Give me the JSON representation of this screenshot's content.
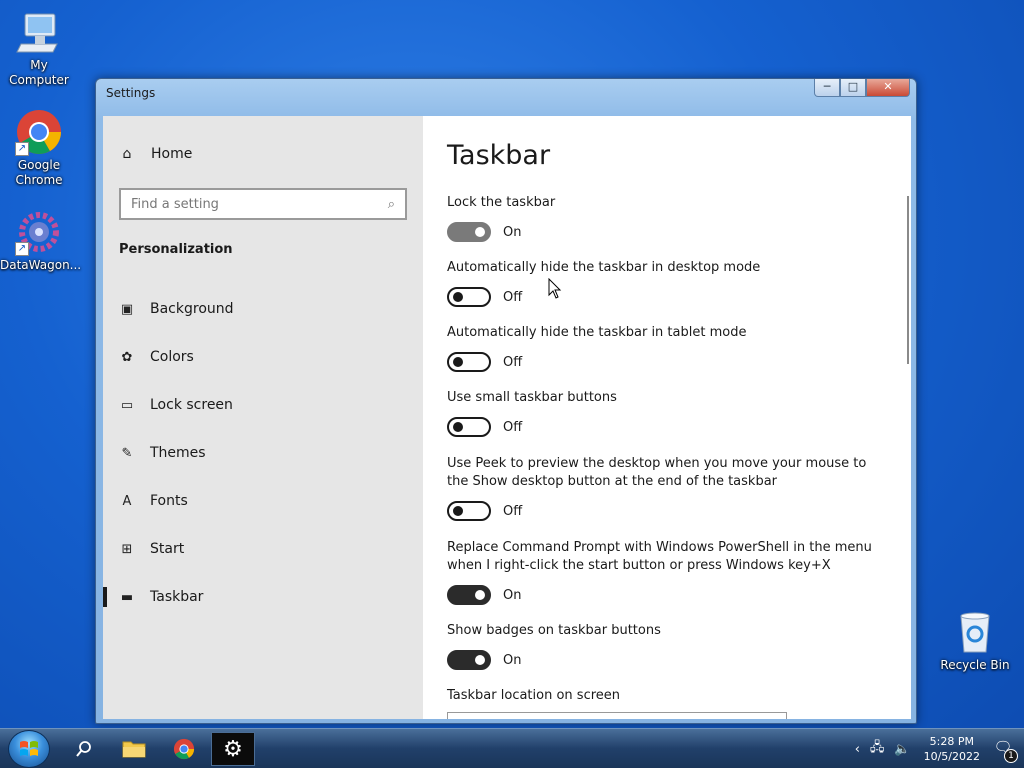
{
  "desktop": {
    "icons": [
      {
        "label": "My Computer",
        "icon": "computer-icon"
      },
      {
        "label": "Google Chrome",
        "icon": "chrome-icon"
      },
      {
        "label": "DataWagon...",
        "icon": "datawagon-icon"
      },
      {
        "label": "Recycle Bin",
        "icon": "recycle-bin-icon"
      }
    ]
  },
  "window": {
    "title": "Settings",
    "controls": {
      "minimize": "─",
      "maximize": "□",
      "close": "✕"
    }
  },
  "sidebar": {
    "home_label": "Home",
    "search_placeholder": "Find a setting",
    "section_title": "Personalization",
    "items": [
      {
        "label": "Background",
        "icon": "image-icon",
        "glyph": "▣"
      },
      {
        "label": "Colors",
        "icon": "palette-icon",
        "glyph": "✿"
      },
      {
        "label": "Lock screen",
        "icon": "lock-screen-icon",
        "glyph": "▭"
      },
      {
        "label": "Themes",
        "icon": "themes-icon",
        "glyph": "✎"
      },
      {
        "label": "Fonts",
        "icon": "fonts-icon",
        "glyph": "A"
      },
      {
        "label": "Start",
        "icon": "start-icon",
        "glyph": "⊞"
      },
      {
        "label": "Taskbar",
        "icon": "taskbar-icon",
        "glyph": "▬",
        "active": true
      }
    ]
  },
  "content": {
    "title": "Taskbar",
    "settings": [
      {
        "label": "Lock the taskbar",
        "state": "On"
      },
      {
        "label": "Automatically hide the taskbar in desktop mode",
        "state": "Off"
      },
      {
        "label": "Automatically hide the taskbar in tablet mode",
        "state": "Off"
      },
      {
        "label": "Use small taskbar buttons",
        "state": "Off"
      },
      {
        "label": "Use Peek to preview the desktop when you move your mouse to the Show desktop button at the end of the taskbar",
        "state": "Off"
      },
      {
        "label": "Replace Command Prompt with Windows PowerShell in the menu when I right-click the start button or press Windows key+X",
        "state": "On"
      },
      {
        "label": "Show badges on taskbar buttons",
        "state": "On"
      }
    ],
    "location_label": "Taskbar location on screen"
  },
  "taskbar": {
    "clock_time": "5:28 PM",
    "clock_date": "10/5/2022",
    "notification_count": "1",
    "tray_icons": [
      "chevron-left-icon",
      "network-icon",
      "volume-icon"
    ]
  },
  "colors": {
    "accent": "#1a1a1a",
    "sidebar_bg": "#e6e6e6",
    "desktop_bg": "#1561d0"
  }
}
